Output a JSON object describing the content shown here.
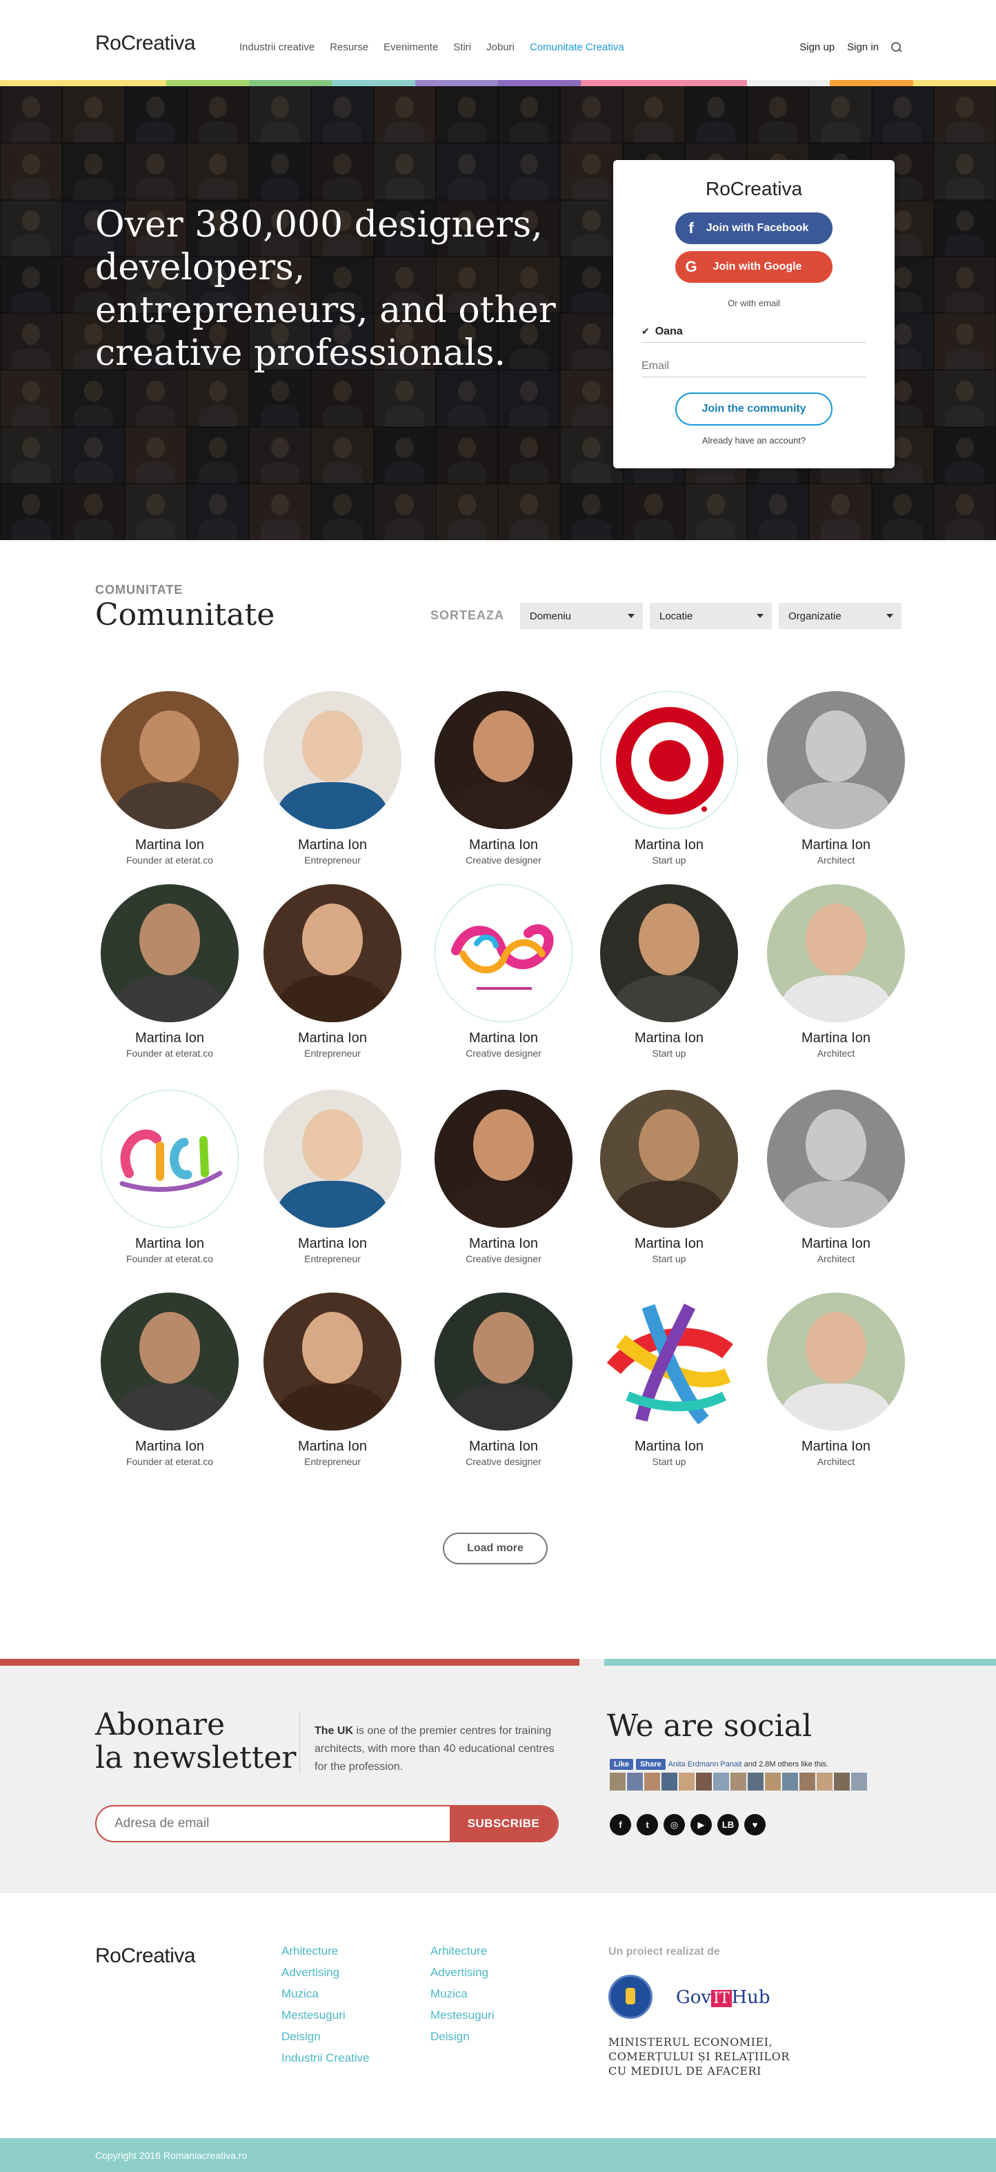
{
  "header": {
    "brand": "RoCreativa",
    "nav": [
      "Industrii creative",
      "Resurse",
      "Evenimente",
      "Stiri",
      "Joburi",
      "Comunitate Creativa"
    ],
    "active_nav": "Comunitate Creativa",
    "sign_up": "Sign up",
    "sign_in": "Sign in",
    "colorbar": [
      "#f7e27a",
      "#f7e27a",
      "#a6d36a",
      "#84c87f",
      "#8ecfcb",
      "#9a86c8",
      "#8c6cbf",
      "#f08aa6",
      "#f08aa6",
      "#eeeeee",
      "#f7a23a",
      "#f7e27a"
    ]
  },
  "hero": {
    "headline": "Over 380,000 designers, developers, entrepreneurs, and other creative professionals.",
    "signup": {
      "brand": "RoCreativa",
      "facebook_btn": "Join with Facebook",
      "google_btn": "Join with Google",
      "or_text": "Or with email",
      "name_value": "Oana",
      "email_placeholder": "Email",
      "join_btn": "Join the community",
      "have_account": "Already have an account?"
    }
  },
  "community": {
    "eyebrow": "COMUNITATE",
    "title": "Comunitate",
    "sort_label": "SORTEAZA",
    "filters": [
      "Domeniu",
      "Locatie",
      "Organizatie"
    ],
    "people": [
      {
        "name": "Martina Ion",
        "role": "Founder at eterat.co",
        "avatar": "photo",
        "skin": "#c08a63",
        "bg": "#7a5030",
        "shirt": "#4a3a30"
      },
      {
        "name": "Martina Ion",
        "role": "Entrepreneur",
        "avatar": "photo",
        "skin": "#e9c7a8",
        "bg": "#e7e2dc",
        "shirt": "#1e5a8c"
      },
      {
        "name": "Martina Ion",
        "role": "Creative designer",
        "avatar": "photo",
        "skin": "#c9916a",
        "bg": "#2a1c16",
        "shirt": "#301e18"
      },
      {
        "name": "Martina Ion",
        "role": "Start up",
        "avatar": "target-logo"
      },
      {
        "name": "Martina Ion",
        "role": "Architect",
        "avatar": "photo",
        "skin": "#c8c8c8",
        "bg": "#8a8a8a",
        "shirt": "#bbbbbb"
      },
      {
        "name": "Martina Ion",
        "role": "Founder at eterat.co",
        "avatar": "photo",
        "skin": "#b98a6a",
        "bg": "#2e3a2e",
        "shirt": "#3a3a3a"
      },
      {
        "name": "Martina Ion",
        "role": "Entrepreneur",
        "avatar": "photo",
        "skin": "#d9a985",
        "bg": "#4a3022",
        "shirt": "#3a2418"
      },
      {
        "name": "Martina Ion",
        "role": "Creative designer",
        "avatar": "company-logo"
      },
      {
        "name": "Martina Ion",
        "role": "Start up",
        "avatar": "photo",
        "skin": "#c8976f",
        "bg": "#2e2e28",
        "shirt": "#3f3f3a"
      },
      {
        "name": "Martina Ion",
        "role": "Architect",
        "avatar": "photo",
        "skin": "#e2b89a",
        "bg": "#b9c8a8",
        "shirt": "#e6e6e6"
      },
      {
        "name": "Martina Ion",
        "role": "Founder at eterat.co",
        "avatar": "cici-logo"
      },
      {
        "name": "Martina Ion",
        "role": "Entrepreneur",
        "avatar": "photo",
        "skin": "#e9c7a8",
        "bg": "#e7e2dc",
        "shirt": "#1e5a8c"
      },
      {
        "name": "Martina Ion",
        "role": "Creative designer",
        "avatar": "photo",
        "skin": "#c9916a",
        "bg": "#2a1c16",
        "shirt": "#301e18"
      },
      {
        "name": "Martina Ion",
        "role": "Start up",
        "avatar": "photo",
        "skin": "#b88a64",
        "bg": "#5a4a38",
        "shirt": "#3e2e22"
      },
      {
        "name": "Martina Ion",
        "role": "Architect",
        "avatar": "photo",
        "skin": "#c8c8c8",
        "bg": "#8a8a8a",
        "shirt": "#bbbbbb"
      },
      {
        "name": "Martina Ion",
        "role": "Founder at eterat.co",
        "avatar": "photo",
        "skin": "#b98a6a",
        "bg": "#2e3a2e",
        "shirt": "#3a3a3a"
      },
      {
        "name": "Martina Ion",
        "role": "Entrepreneur",
        "avatar": "photo",
        "skin": "#d9a985",
        "bg": "#4a3022",
        "shirt": "#3a2418"
      },
      {
        "name": "Martina Ion",
        "role": "Creative designer",
        "avatar": "photo",
        "skin": "#b98a6a",
        "bg": "#28302a",
        "shirt": "#333333"
      },
      {
        "name": "Martina Ion",
        "role": "Start up",
        "avatar": "ribbon-logo"
      },
      {
        "name": "Martina Ion",
        "role": "Architect",
        "avatar": "photo",
        "skin": "#e2b89a",
        "bg": "#b9c8a8",
        "shirt": "#e6e6e6"
      }
    ],
    "load_more": "Load more"
  },
  "newsletter": {
    "title_line1": "Abonare",
    "title_line2": "la newsletter",
    "text_bold": "The UK",
    "text_rest": " is one of the premier centres for training architects, with more than 40 educational centres for the profession.",
    "email_placeholder": "Adresa de email",
    "subscribe": "SUBSCRIBE",
    "accent": "#c74f47"
  },
  "social": {
    "title": "We are social",
    "fb_like": "Like",
    "fb_share": "Share",
    "fb_who": "Anita Erdmann Panait",
    "fb_rest": " and 2.8M others like this.",
    "icons": [
      "facebook-icon",
      "twitter-icon",
      "instagram-icon",
      "youtube-icon",
      "lb-icon",
      "heart-icon"
    ],
    "icon_glyphs": [
      "f",
      "t",
      "◎",
      "▶",
      "LB",
      "♥"
    ]
  },
  "footer": {
    "brand": "RoCreativa",
    "col1": [
      "Arhitecture",
      "Advertising",
      "Muzica",
      "Mestesuguri",
      "Deisign",
      "Industrii Creative"
    ],
    "col2": [
      "Arhitecture",
      "Advertising",
      "Muzica",
      "Mestesuguri",
      "Deisign"
    ],
    "project_label": "Un proiect realizat de",
    "govithub_pre": "Gov",
    "govithub_it": "IT",
    "govithub_post": "Hub",
    "ministry": [
      "MINISTERUL ECONOMIEI,",
      "COMERȚULUI ȘI RELAȚIILOR",
      "CU MEDIUL DE AFACERI"
    ],
    "copyright": "Copyright 2016 Romaniacreativa.ro"
  }
}
